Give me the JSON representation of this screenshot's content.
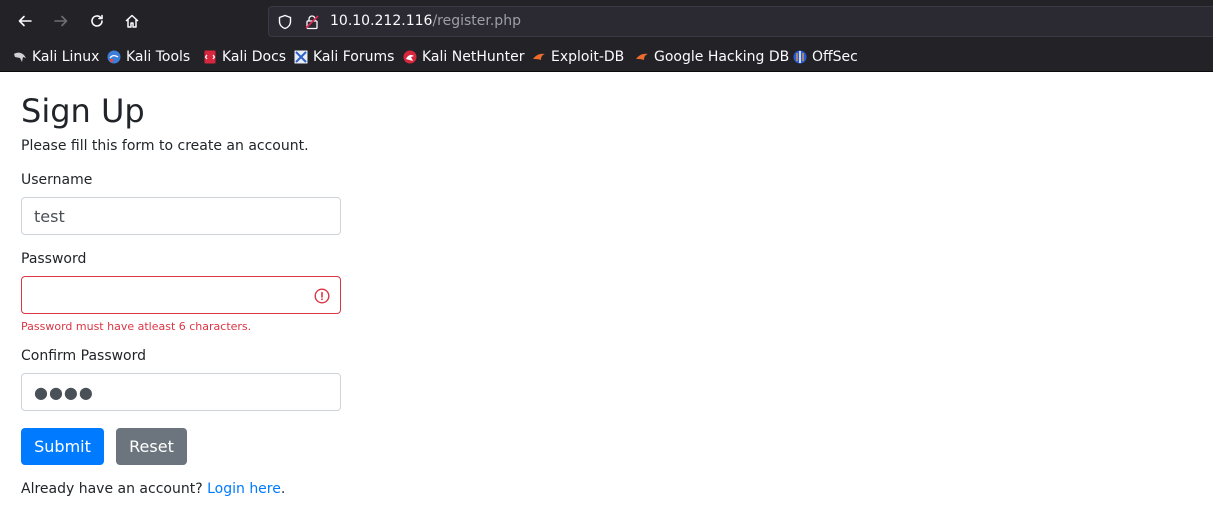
{
  "browser": {
    "url_host": "10.10.212.116",
    "url_path": "/register.php",
    "bookmarks": [
      {
        "label": "Kali Linux",
        "icon": "kali-dragon-icon"
      },
      {
        "label": "Kali Tools",
        "icon": "kali-tools-icon"
      },
      {
        "label": "Kali Docs",
        "icon": "kali-docs-icon"
      },
      {
        "label": "Kali Forums",
        "icon": "kali-forums-icon"
      },
      {
        "label": "Kali NetHunter",
        "icon": "kali-nethunter-icon"
      },
      {
        "label": "Exploit-DB",
        "icon": "exploit-db-icon"
      },
      {
        "label": "Google Hacking DB",
        "icon": "google-hacking-db-icon"
      },
      {
        "label": "OffSec",
        "icon": "offsec-icon"
      }
    ]
  },
  "form": {
    "title": "Sign Up",
    "subtitle": "Please fill this form to create an account.",
    "username_label": "Username",
    "username_value": "test",
    "password_label": "Password",
    "password_value": "",
    "password_error": "Password must have atleast 6 characters.",
    "confirm_label": "Confirm Password",
    "confirm_value": "●●●●",
    "submit_label": "Submit",
    "reset_label": "Reset",
    "footer_text": "Already have an account? ",
    "login_link": "Login here",
    "footer_end": "."
  },
  "colors": {
    "primary": "#007bff",
    "secondary": "#6c757d",
    "danger": "#dc3545",
    "chrome_bg": "#232327"
  }
}
